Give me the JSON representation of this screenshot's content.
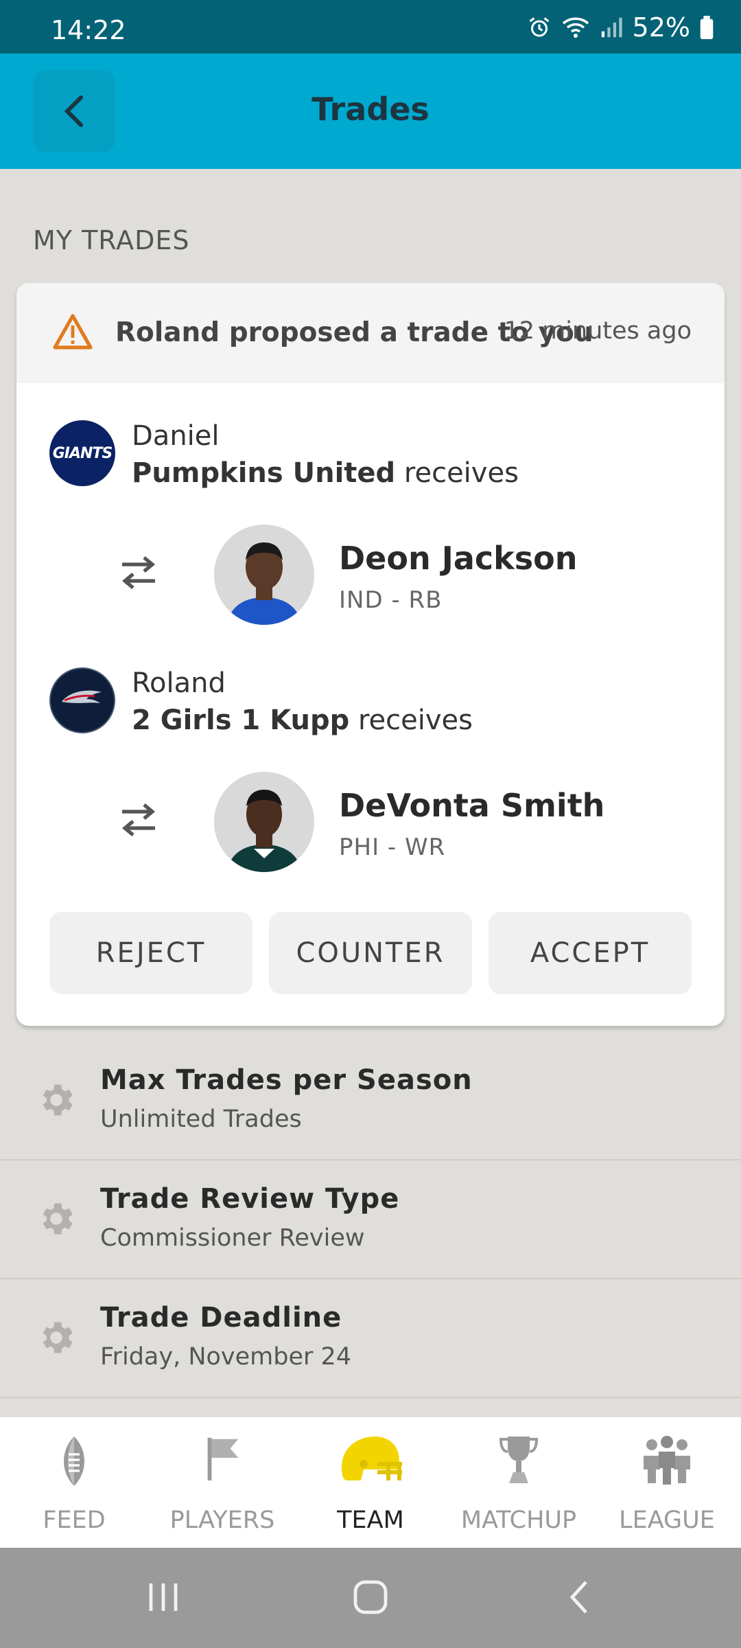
{
  "status_bar": {
    "time": "14:22",
    "battery": "52%"
  },
  "header": {
    "title": "Trades"
  },
  "section": {
    "title": "MY TRADES"
  },
  "trade": {
    "notice_text": "Roland proposed a trade to you",
    "notice_time": "12 minutes ago",
    "parties": [
      {
        "owner": "Daniel",
        "team": "Pumpkins United",
        "receives_label": "receives",
        "player": {
          "name": "Deon Jackson",
          "position": "IND - RB"
        }
      },
      {
        "owner": "Roland",
        "team": "2 Girls 1 Kupp",
        "receives_label": "receives",
        "player": {
          "name": "DeVonta Smith",
          "position": "PHI - WR"
        }
      }
    ],
    "actions": {
      "reject": "REJECT",
      "counter": "COUNTER",
      "accept": "ACCEPT"
    }
  },
  "settings": [
    {
      "title": "Max Trades per Season",
      "value": "Unlimited Trades"
    },
    {
      "title": "Trade Review Type",
      "value": "Commissioner Review"
    },
    {
      "title": "Trade Deadline",
      "value": "Friday, November 24"
    }
  ],
  "bottom_nav": [
    {
      "label": "FEED",
      "icon": "football-icon"
    },
    {
      "label": "PLAYERS",
      "icon": "flag-icon"
    },
    {
      "label": "TEAM",
      "icon": "helmet-icon",
      "active": true
    },
    {
      "label": "MATCHUP",
      "icon": "trophy-icon"
    },
    {
      "label": "LEAGUE",
      "icon": "people-icon"
    }
  ],
  "logo_text": {
    "giants": "GIANTS"
  },
  "colors": {
    "header": "#00a9d0",
    "status_bar": "#036276",
    "warning": "#e07a1f",
    "active_helmet": "#f2d500"
  }
}
